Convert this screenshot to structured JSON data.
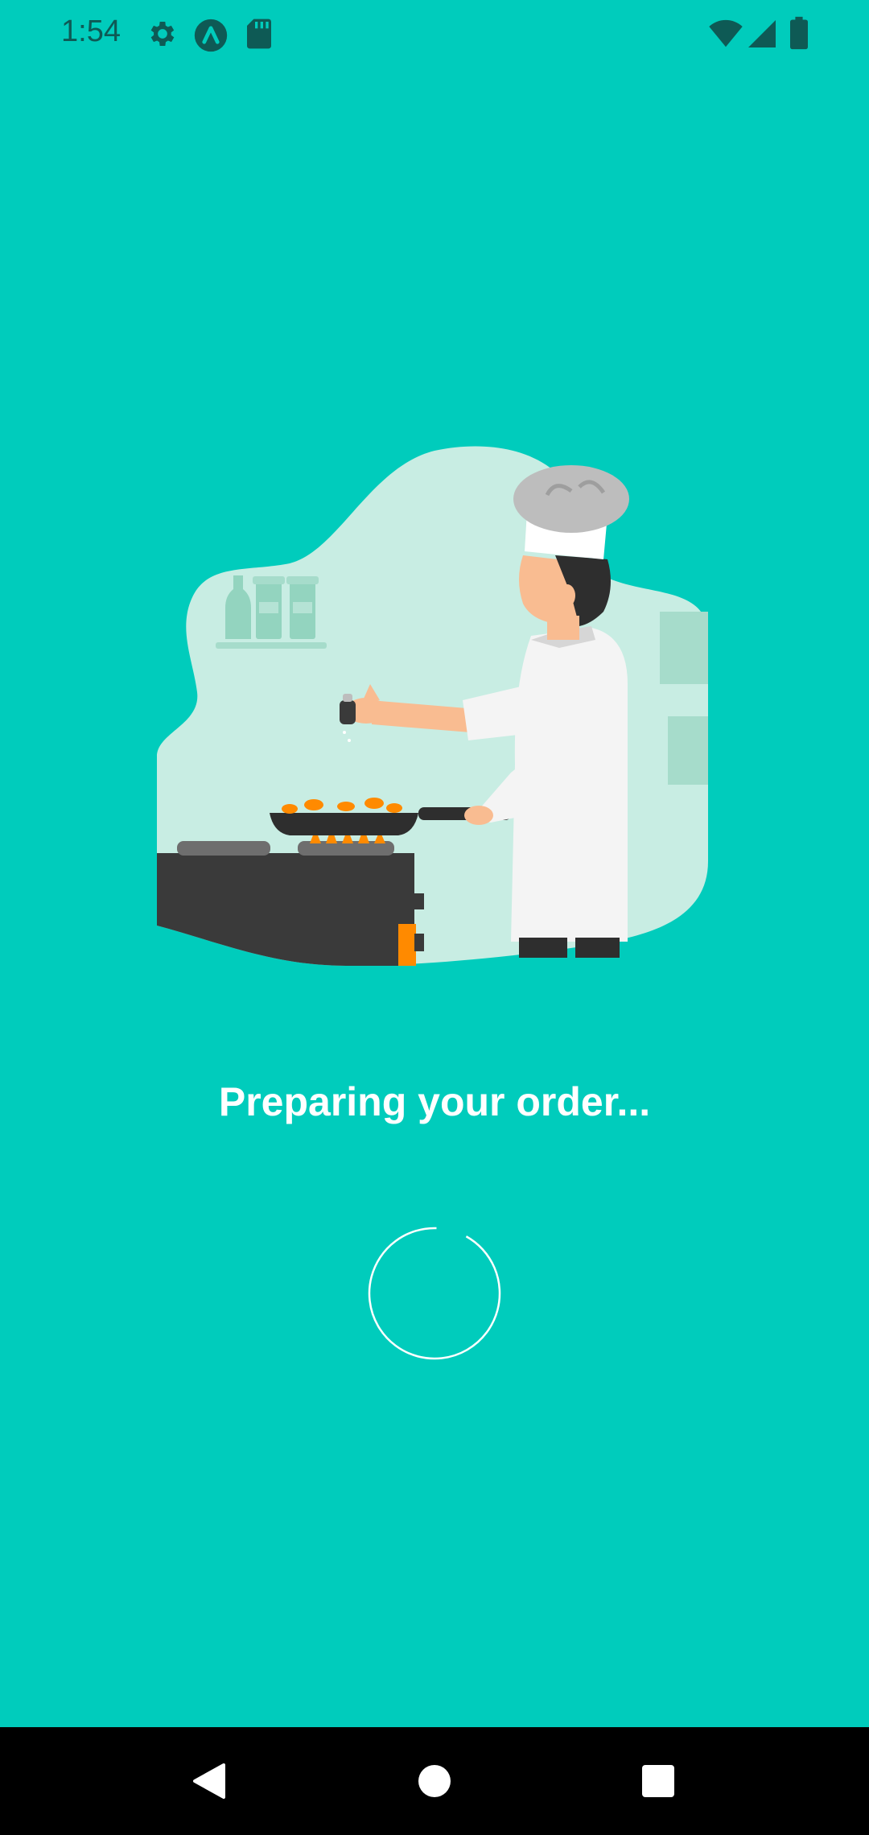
{
  "status_bar": {
    "time": "1:54",
    "left_icons": [
      "gear-icon",
      "app-logo-icon",
      "sd-card-icon"
    ],
    "right_icons": [
      "wifi-icon",
      "cell-signal-icon",
      "battery-icon"
    ],
    "icon_color": "#0E5A55"
  },
  "main": {
    "title": "Preparing your order...",
    "background_color": "#00CCBC",
    "illustration": "chef-cooking-illustration",
    "spinner": "loading-spinner"
  },
  "nav_bar": {
    "buttons": [
      "back-icon",
      "home-icon",
      "recents-icon"
    ]
  }
}
